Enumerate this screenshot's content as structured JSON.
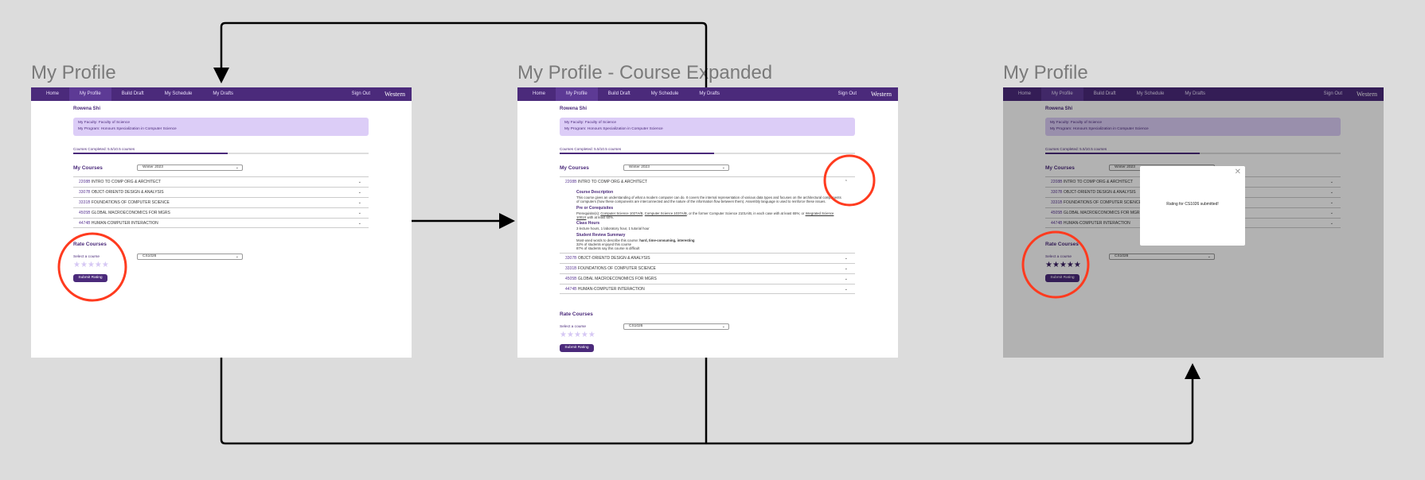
{
  "panels": [
    {
      "title": "My Profile",
      "state": "default"
    },
    {
      "title": "My Profile - Course Expanded",
      "state": "expanded"
    },
    {
      "title": "My Profile",
      "state": "submitted"
    }
  ],
  "nav": {
    "items": [
      "Home",
      "My Profile",
      "Build Draft",
      "My Schedule",
      "My Drafts"
    ],
    "active": 1,
    "sign_out": "Sign Out",
    "logo": "Western"
  },
  "profile": {
    "name": "Rowena Shi",
    "faculty": "My Faculty: Faculty of Science",
    "program": "My Program: Honours Specialization in Computer Science",
    "progress_label": "Courses Completed: 5.5/10.5 courses",
    "progress_fraction": 0.524
  },
  "courses": {
    "heading": "My Courses",
    "term": "Winter 2023",
    "items": [
      {
        "code": "2208B",
        "name": "INTRO TO COMP ORG & ARCHITECT"
      },
      {
        "code": "3307B",
        "name": "OBJCT-ORIENTD DESIGN & ANALYSIS"
      },
      {
        "code": "3331B",
        "name": "FOUNDATIONS OF COMPUTER SCIENCE"
      },
      {
        "code": "4505B",
        "name": "GLOBAL MACROECONOMICS FOR MGRS"
      },
      {
        "code": "4474B",
        "name": "HUMAN-COMPUTER INTERACTION"
      }
    ]
  },
  "detail": {
    "desc_h": "Course Description",
    "desc": "This course gives an understanding of what a modern computer can do. It covers the internal representation of various data types and focuses on the architectural components of computers (how these components are interconnected and the nature of the information flow between them). Assembly language is used to reinforce these issues.",
    "prereq_h": "Pre or Corequisites",
    "prereq_a": "Prerequisite(s): ",
    "prereq_l1": "Computer Science 1027A/B",
    "prereq_b": ", ",
    "prereq_l2": "Computer Science 1037A/B",
    "prereq_c": ", or the former Computer Science 2101A/B, in each case with at least 65%; or ",
    "prereq_l3": "Integrated Science 1001X",
    "prereq_d": " with at least 60%.",
    "hours_h": "Class Hours",
    "hours": "3 lecture hours, 1 laboratory hour, 1 tutorial hour",
    "review_h": "Student Review Summary",
    "review_a": "Most-used words to describe this course: ",
    "review_words": "hard, time-consuming, interesting",
    "review_1": "32% of students enjoyed this course",
    "review_2": "87% of students say this course is difficult"
  },
  "rate": {
    "heading": "Rate Courses",
    "select_label": "Select a course",
    "selected": "CS1026",
    "stars_default": 0,
    "stars_submitted": 5,
    "max_stars": 5,
    "submit": "Submit Rating"
  },
  "modal": {
    "message": "Rating for CS1026 submitted!"
  },
  "colors": {
    "brand": "#4b2a7b",
    "highlight": "#ff3b1f"
  }
}
